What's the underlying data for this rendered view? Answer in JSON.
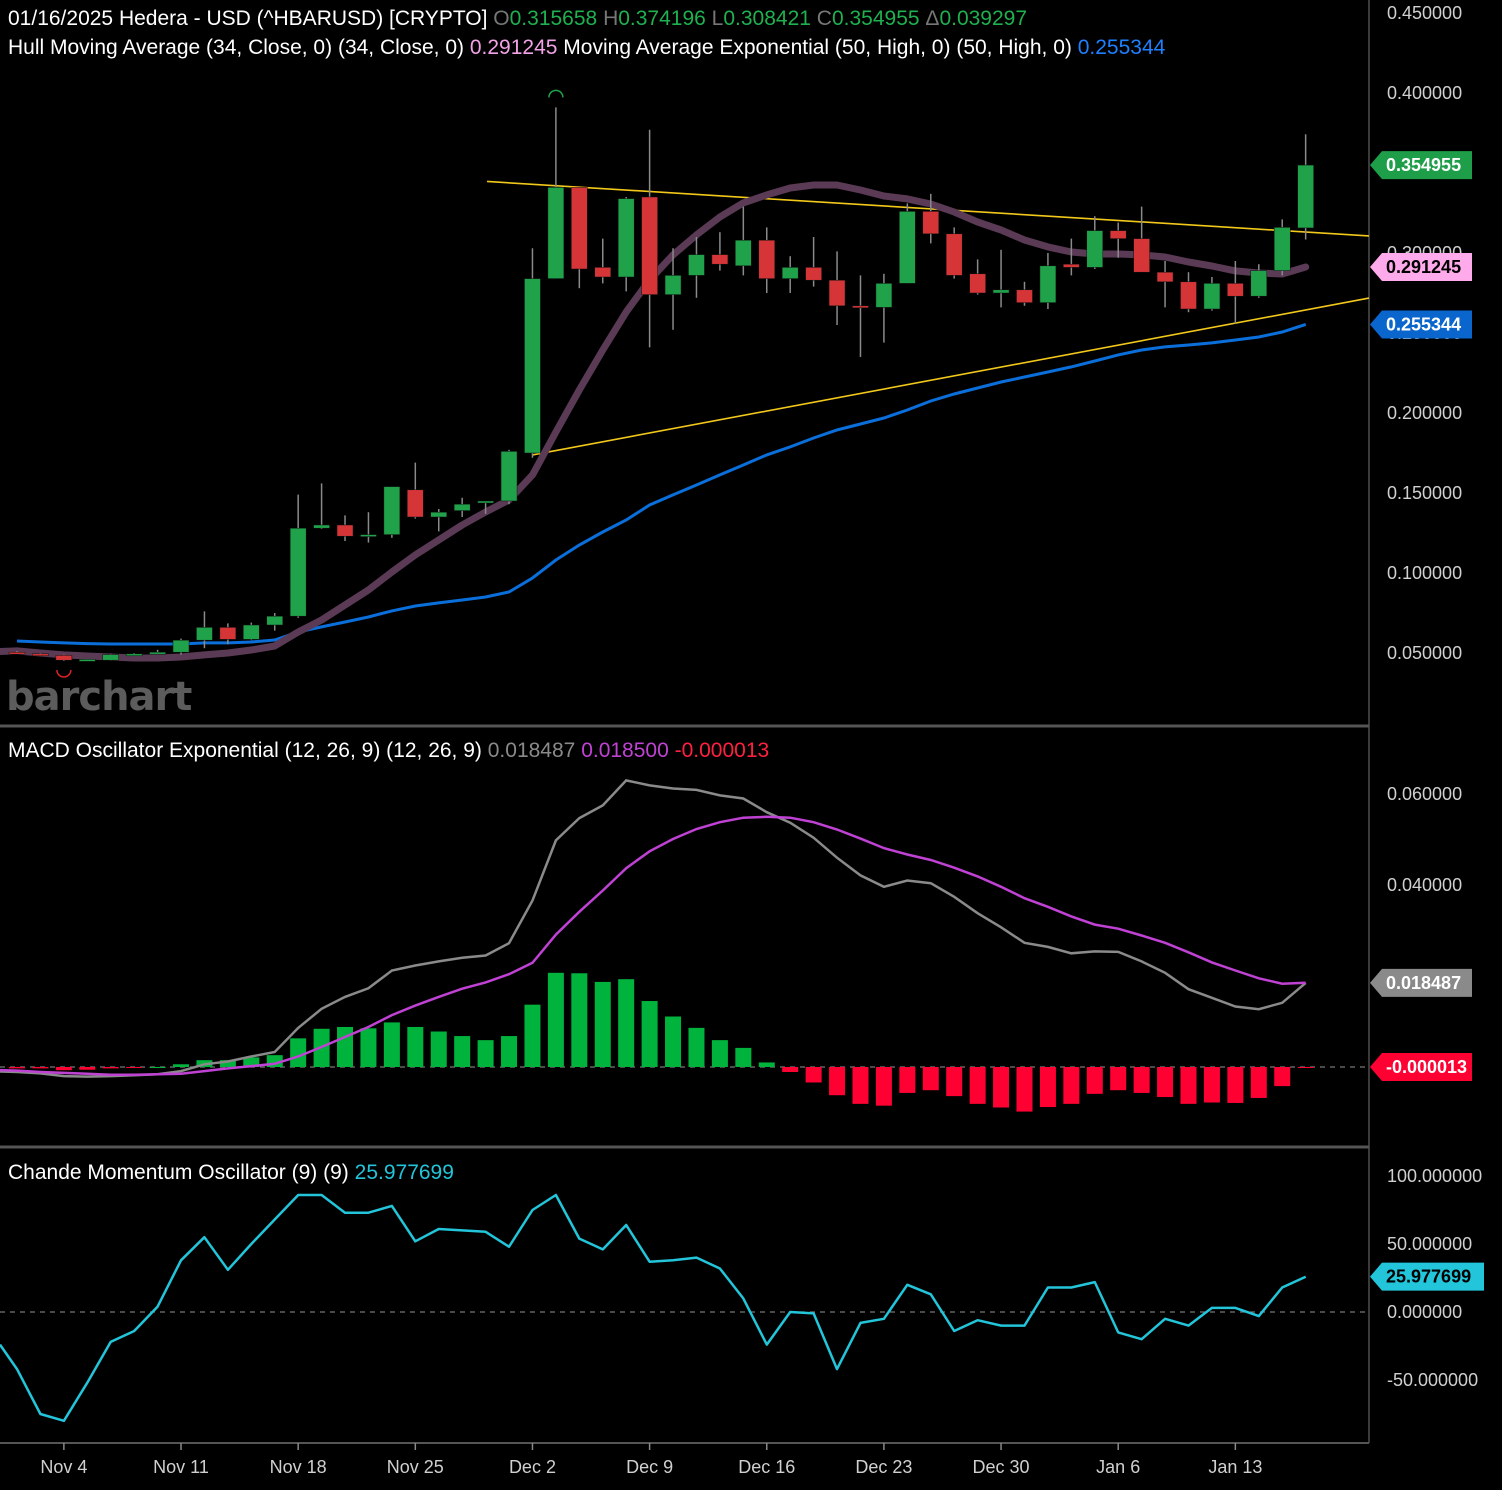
{
  "header": {
    "date": "01/16/2025",
    "instrument": "Hedera - USD (^HBARUSD) [CRYPTO]",
    "open_label": "O",
    "open": "0.315658",
    "high_label": "H",
    "high": "0.374196",
    "low_label": "L",
    "low": "0.308421",
    "close_label": "C",
    "close": "0.354955",
    "change_label": "Δ",
    "change": "0.039297"
  },
  "overlays": {
    "hull": {
      "label": "Hull Moving Average (34, Close, 0)",
      "params": "(34, Close, 0)",
      "value": "0.291245",
      "color": "#5a3a55",
      "value_color": "#f2a2e6"
    },
    "ema": {
      "label": "Moving Average Exponential (50, High, 0)",
      "params": "(50, High, 0)",
      "value": "0.255344",
      "color": "#0a6fdb",
      "value_color": "#1e80ff"
    }
  },
  "macd_header": {
    "label": "MACD Oscillator Exponential (12, 26, 9)",
    "params": "(12, 26, 9)",
    "macd": "0.018487",
    "signal": "0.018500",
    "histogram": "-0.000013"
  },
  "cmo_header": {
    "label": "Chande Momentum Oscillator (9)",
    "params": "(9)",
    "value": "25.977699"
  },
  "watermark": "barchart",
  "colors": {
    "up": "#1fa24a",
    "down": "#d63538",
    "hist_up": "#00b33c",
    "hist_down": "#ff0033",
    "trendline": "#f2c81a",
    "macd": "#8a8a8a",
    "signal": "#c042d4",
    "cmo": "#22c5da",
    "background": "#000000"
  },
  "x_axis": {
    "ticks": [
      "Nov 4",
      "Nov 11",
      "Nov 18",
      "Nov 25",
      "Dec 2",
      "Dec 9",
      "Dec 16",
      "Dec 23",
      "Dec 30",
      "Jan 6",
      "Jan 13"
    ]
  },
  "chart_data": [
    {
      "type": "candlestick",
      "pane": "price",
      "ylim": [
        0.0,
        0.45
      ],
      "y_ticks": [
        "0.450000",
        "0.400000",
        "0.350000",
        "0.300000",
        "0.250000",
        "0.200000",
        "0.150000",
        "0.100000",
        "0.050000"
      ],
      "dates": [
        "Oct 31",
        "Nov 1",
        "Nov 4",
        "Nov 5",
        "Nov 6",
        "Nov 7",
        "Nov 8",
        "Nov 11",
        "Nov 12",
        "Nov 13",
        "Nov 14",
        "Nov 15",
        "Nov 18",
        "Nov 19",
        "Nov 20",
        "Nov 21",
        "Nov 22",
        "Nov 25",
        "Nov 26",
        "Nov 27",
        "Nov 28",
        "Nov 29",
        "Dec 2",
        "Dec 3",
        "Dec 4",
        "Dec 5",
        "Dec 6",
        "Dec 9",
        "Dec 10",
        "Dec 11",
        "Dec 12",
        "Dec 13",
        "Dec 16",
        "Dec 17",
        "Dec 18",
        "Dec 19",
        "Dec 20",
        "Dec 23",
        "Dec 24",
        "Dec 25",
        "Dec 26",
        "Dec 27",
        "Dec 30",
        "Dec 31",
        "Jan 1",
        "Jan 2",
        "Jan 3",
        "Jan 6",
        "Jan 7",
        "Jan 8",
        "Jan 9",
        "Jan 10",
        "Jan 13",
        "Jan 14",
        "Jan 15",
        "Jan 16"
      ],
      "ohlc": [
        [
          0.0505,
          0.0512,
          0.0498,
          0.05
        ],
        [
          0.0495,
          0.05,
          0.0483,
          0.0485
        ],
        [
          0.0485,
          0.049,
          0.045,
          0.0455
        ],
        [
          0.0455,
          0.0462,
          0.0452,
          0.046
        ],
        [
          0.0455,
          0.0495,
          0.0452,
          0.049
        ],
        [
          0.049,
          0.05,
          0.0485,
          0.0495
        ],
        [
          0.0495,
          0.052,
          0.0492,
          0.0505
        ],
        [
          0.0505,
          0.059,
          0.049,
          0.058
        ],
        [
          0.058,
          0.076,
          0.053,
          0.066
        ],
        [
          0.066,
          0.0685,
          0.0555,
          0.0585
        ],
        [
          0.0585,
          0.069,
          0.058,
          0.0675
        ],
        [
          0.0675,
          0.075,
          0.064,
          0.073
        ],
        [
          0.073,
          0.149,
          0.072,
          0.128
        ],
        [
          0.128,
          0.156,
          0.1275,
          0.13
        ],
        [
          0.13,
          0.136,
          0.12,
          0.123
        ],
        [
          0.123,
          0.138,
          0.119,
          0.124
        ],
        [
          0.124,
          0.154,
          0.122,
          0.154
        ],
        [
          0.152,
          0.169,
          0.134,
          0.135
        ],
        [
          0.135,
          0.14,
          0.126,
          0.138
        ],
        [
          0.139,
          0.147,
          0.135,
          0.143
        ],
        [
          0.144,
          0.145,
          0.137,
          0.145
        ],
        [
          0.145,
          0.177,
          0.143,
          0.176
        ],
        [
          0.175,
          0.303,
          0.172,
          0.284
        ],
        [
          0.284,
          0.391,
          0.284,
          0.341
        ],
        [
          0.341,
          0.341,
          0.278,
          0.29
        ],
        [
          0.291,
          0.309,
          0.281,
          0.285
        ],
        [
          0.285,
          0.335,
          0.276,
          0.334
        ],
        [
          0.335,
          0.377,
          0.241,
          0.274
        ],
        [
          0.274,
          0.303,
          0.252,
          0.286
        ],
        [
          0.286,
          0.31,
          0.272,
          0.299
        ],
        [
          0.299,
          0.313,
          0.289,
          0.293
        ],
        [
          0.292,
          0.329,
          0.286,
          0.308
        ],
        [
          0.308,
          0.316,
          0.275,
          0.284
        ],
        [
          0.284,
          0.298,
          0.275,
          0.291
        ],
        [
          0.291,
          0.31,
          0.279,
          0.283
        ],
        [
          0.283,
          0.301,
          0.255,
          0.267
        ],
        [
          0.267,
          0.286,
          0.235,
          0.266
        ],
        [
          0.266,
          0.287,
          0.244,
          0.281
        ],
        [
          0.281,
          0.331,
          0.281,
          0.326
        ],
        [
          0.326,
          0.337,
          0.306,
          0.312
        ],
        [
          0.312,
          0.316,
          0.284,
          0.286
        ],
        [
          0.287,
          0.296,
          0.274,
          0.275
        ],
        [
          0.275,
          0.302,
          0.266,
          0.277
        ],
        [
          0.277,
          0.282,
          0.267,
          0.269
        ],
        [
          0.269,
          0.3,
          0.265,
          0.292
        ],
        [
          0.293,
          0.309,
          0.286,
          0.291
        ],
        [
          0.291,
          0.323,
          0.29,
          0.314
        ],
        [
          0.314,
          0.319,
          0.297,
          0.309
        ],
        [
          0.309,
          0.329,
          0.288,
          0.288
        ],
        [
          0.288,
          0.295,
          0.266,
          0.282
        ],
        [
          0.282,
          0.288,
          0.263,
          0.265
        ],
        [
          0.265,
          0.285,
          0.264,
          0.281
        ],
        [
          0.281,
          0.295,
          0.256,
          0.273
        ],
        [
          0.273,
          0.293,
          0.272,
          0.289
        ],
        [
          0.289,
          0.321,
          0.286,
          0.316
        ],
        [
          0.315658,
          0.374196,
          0.308421,
          0.354955
        ]
      ],
      "hull_ma": [
        0.0513,
        0.05,
        0.0488,
        0.0481,
        0.0475,
        0.0469,
        0.0469,
        0.0475,
        0.0488,
        0.05,
        0.0519,
        0.0544,
        0.0631,
        0.0706,
        0.08,
        0.0894,
        0.1006,
        0.1113,
        0.1206,
        0.13,
        0.1381,
        0.1456,
        0.1613,
        0.1881,
        0.2144,
        0.2394,
        0.2631,
        0.2831,
        0.2988,
        0.3113,
        0.3225,
        0.3313,
        0.3363,
        0.3406,
        0.3425,
        0.3425,
        0.3394,
        0.3356,
        0.3338,
        0.3306,
        0.3256,
        0.3194,
        0.3144,
        0.3081,
        0.3038,
        0.3006,
        0.2994,
        0.2994,
        0.2988,
        0.2975,
        0.2944,
        0.2919,
        0.2888,
        0.2875,
        0.2869,
        0.291245
      ],
      "ema": [
        0.0575,
        0.0569,
        0.0563,
        0.0559,
        0.0556,
        0.0556,
        0.0556,
        0.0556,
        0.0563,
        0.0563,
        0.0569,
        0.0581,
        0.0631,
        0.0663,
        0.0694,
        0.0725,
        0.0763,
        0.0794,
        0.0813,
        0.0831,
        0.085,
        0.0881,
        0.0969,
        0.1081,
        0.1175,
        0.1256,
        0.1331,
        0.1425,
        0.1488,
        0.155,
        0.1613,
        0.1675,
        0.1738,
        0.1788,
        0.1844,
        0.1894,
        0.1931,
        0.1969,
        0.2019,
        0.2075,
        0.2119,
        0.2156,
        0.2194,
        0.2225,
        0.2256,
        0.2288,
        0.2325,
        0.2363,
        0.2394,
        0.2413,
        0.2425,
        0.2438,
        0.2456,
        0.2475,
        0.2506,
        0.255344
      ],
      "trendlines": [
        {
          "from": {
            "date": "Nov 29",
            "price": 0.3438
          },
          "to": {
            "date": "Jan 16",
            "price": 0.3131
          }
        },
        {
          "from": {
            "date": "Dec 2",
            "price": 0.1738
          },
          "to": {
            "date": "Jan 16",
            "price": 0.2644
          }
        }
      ],
      "markers": [
        {
          "date": "Dec 3",
          "type": "high"
        },
        {
          "date": "Nov 4",
          "type": "low"
        }
      ],
      "last_labels": [
        {
          "value": "0.354955",
          "bg": "#1e9e48",
          "fg": "#ffffff"
        },
        {
          "value": "0.291245",
          "bg": "#ffaaea",
          "fg": "#000000"
        },
        {
          "value": "0.255344",
          "bg": "#0a66cc",
          "fg": "#ffffff"
        }
      ]
    },
    {
      "type": "macd",
      "pane": "macd",
      "y_ticks": [
        "0.060000",
        "0.040000",
        "0.020000"
      ],
      "macd": [
        -0.0011,
        -0.0014,
        -0.002,
        -0.0021,
        -0.002,
        -0.0018,
        -0.0016,
        -0.0009,
        0.0006,
        0.0012,
        0.0023,
        0.0033,
        0.0086,
        0.0128,
        0.0154,
        0.0173,
        0.0212,
        0.0223,
        0.0232,
        0.024,
        0.0245,
        0.0272,
        0.0366,
        0.0498,
        0.0547,
        0.0575,
        0.063,
        0.0619,
        0.0612,
        0.0609,
        0.0597,
        0.059,
        0.056,
        0.0537,
        0.0504,
        0.046,
        0.0421,
        0.0396,
        0.041,
        0.0404,
        0.0374,
        0.0338,
        0.0307,
        0.0273,
        0.0264,
        0.025,
        0.0254,
        0.0253,
        0.0232,
        0.0207,
        0.0171,
        0.0152,
        0.0133,
        0.0127,
        0.0141,
        0.018487
      ],
      "signal": [
        -0.0008,
        -0.0011,
        -0.0013,
        -0.0015,
        -0.0017,
        -0.0017,
        -0.0016,
        -0.0015,
        -0.0009,
        -0.0003,
        0.0002,
        0.0007,
        0.0023,
        0.0044,
        0.0066,
        0.0088,
        0.0114,
        0.0135,
        0.0154,
        0.0172,
        0.0186,
        0.0204,
        0.0229,
        0.0291,
        0.0341,
        0.0388,
        0.0437,
        0.0474,
        0.0501,
        0.0523,
        0.0538,
        0.0548,
        0.055,
        0.0548,
        0.0538,
        0.0522,
        0.0502,
        0.0481,
        0.0467,
        0.0455,
        0.0438,
        0.0419,
        0.0396,
        0.0371,
        0.0352,
        0.0331,
        0.0313,
        0.0304,
        0.0289,
        0.0273,
        0.0252,
        0.023,
        0.0212,
        0.0195,
        0.0183,
        0.0185
      ],
      "histogram": [
        -0.0003,
        -0.0003,
        -0.0007,
        -0.0006,
        -0.0003,
        -0.0001,
        0.0,
        0.0006,
        0.0015,
        0.0015,
        0.0021,
        0.0026,
        0.0063,
        0.0084,
        0.0088,
        0.0085,
        0.0098,
        0.0088,
        0.0078,
        0.0068,
        0.0059,
        0.0068,
        0.0137,
        0.0207,
        0.0206,
        0.0187,
        0.0193,
        0.0145,
        0.0111,
        0.0086,
        0.0059,
        0.0042,
        0.001,
        -0.0011,
        -0.0034,
        -0.0062,
        -0.0081,
        -0.0085,
        -0.0057,
        -0.0051,
        -0.0064,
        -0.0081,
        -0.0089,
        -0.0098,
        -0.0088,
        -0.0081,
        -0.0059,
        -0.0051,
        -0.0057,
        -0.0066,
        -0.0081,
        -0.0078,
        -0.0079,
        -0.0068,
        -0.0042,
        -1.3e-05
      ],
      "last_labels": [
        {
          "value": "0.018487",
          "bg": "#8a8a8a",
          "fg": "#ffffff",
          "series": "macd"
        },
        {
          "value": "-0.000013",
          "bg": "#ff0033",
          "fg": "#ffffff",
          "series": "histogram"
        }
      ]
    },
    {
      "type": "line",
      "pane": "cmo",
      "y_ticks": [
        "100.000000",
        "50.000000",
        "0.000000",
        "-50.000000"
      ],
      "values": [
        -42,
        -75,
        -80,
        -52,
        -22,
        -14,
        4,
        38,
        55,
        31,
        50,
        68,
        86,
        86,
        73,
        73,
        78,
        52,
        61,
        60,
        59,
        48,
        75,
        86,
        54,
        46,
        64,
        37,
        38,
        40,
        32,
        10,
        -24,
        0,
        -1,
        -42,
        -8,
        -5,
        20,
        13,
        -14,
        -6,
        -10,
        -10,
        18,
        18,
        22,
        -15,
        -20,
        -5,
        -10,
        3,
        3,
        -3,
        18,
        25.977699
      ],
      "last_labels": [
        {
          "value": "25.977699",
          "bg": "#22c5da",
          "fg": "#000000"
        }
      ]
    }
  ]
}
